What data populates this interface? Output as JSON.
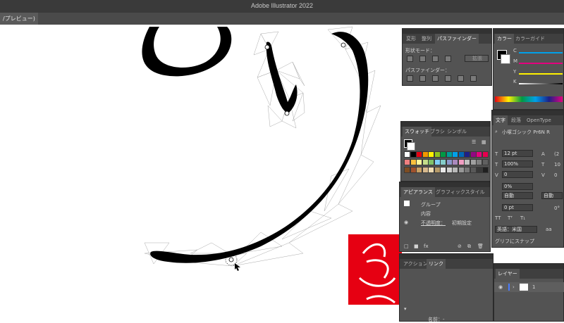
{
  "app": {
    "title": "Adobe Illustrator 2022"
  },
  "document": {
    "tab_label": "/プレビュー)"
  },
  "pathfinder_panel": {
    "tabs": [
      "変形",
      "整列",
      "パスファインダー"
    ],
    "shape_mode_label": "形状モード：",
    "expand_label": "拡張",
    "pathfinders_label": "パスファインダー："
  },
  "color_panel": {
    "tabs": [
      "カラー",
      "カラーガイド"
    ],
    "channels": [
      "C",
      "M",
      "Y",
      "K"
    ],
    "channel_colors": [
      "#00a0e9",
      "#e4007f",
      "#fff100",
      "#000000"
    ]
  },
  "swatches_panel": {
    "tabs": [
      "スウォッチ",
      "ブラシ",
      "シンボル"
    ],
    "swatch_colors": [
      "#ffffff",
      "#000000",
      "#e60012",
      "#f39800",
      "#fff100",
      "#8fc31f",
      "#009944",
      "#009e96",
      "#00a0e9",
      "#0068b7",
      "#1d2088",
      "#920783",
      "#e4007f",
      "#e5004f",
      "#f08080",
      "#fac03d",
      "#fff799",
      "#c4dd8a",
      "#80c269",
      "#7ecef4",
      "#84ccc9",
      "#8c97cb",
      "#aa89bd",
      "#f19ec2",
      "#c0c0c0",
      "#a0a0a0",
      "#808080",
      "#606060",
      "#7d4c22",
      "#a0522d",
      "#c9a063",
      "#d7b98e",
      "#eedcb3",
      "#b59a6a",
      "#e8e8e8",
      "#d0d0d0",
      "#b8b8b8",
      "#989898",
      "#787878",
      "#585858",
      "#383838",
      "#202020"
    ]
  },
  "appearance_panel": {
    "tabs": [
      "アピアランス",
      "グラフィックスタイル"
    ],
    "group_label": "グループ",
    "contents_label": "内容",
    "opacity_label": "不透明度：",
    "opacity_value": "初期設定"
  },
  "character_panel": {
    "tabs": [
      "文字",
      "段落",
      "OpenType"
    ],
    "font_family": "小塚ゴシック Pr6N R",
    "font_size": "12 pt",
    "vertical_scale": "100%",
    "tracking": "0",
    "tsume": "0%",
    "auto1": "自動",
    "auto2": "自動",
    "baseline": "0 pt",
    "baseline_right": "0°",
    "size_right": "(2",
    "lead_right": "10",
    "track_right": "0",
    "type_tt1": "TT",
    "type_tt2": "Tᵀ",
    "type_tt3": "T₁",
    "language": "英語：米国",
    "aa_label": "aa",
    "glyph_snap": "グリフにスナップ"
  },
  "actions_panel": {
    "tabs": [
      "アクション",
      "リンク"
    ],
    "name_label": "名前：-"
  },
  "layers_panel": {
    "tabs": [
      "レイヤー"
    ],
    "layer_number": "1"
  }
}
